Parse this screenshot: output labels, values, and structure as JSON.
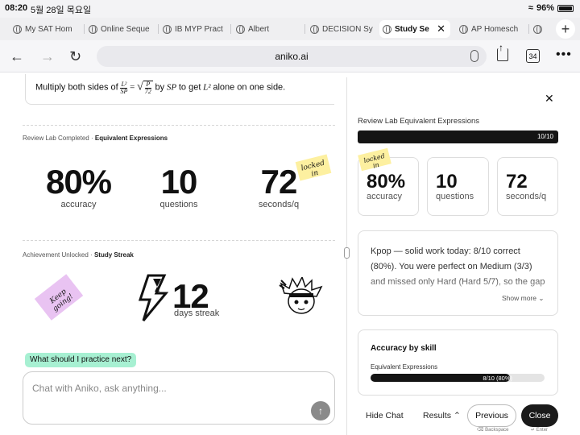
{
  "status": {
    "time": "08:20",
    "date": "5월 28일 목요일",
    "battery": "96%"
  },
  "tabs": [
    {
      "label": "My SAT Hom",
      "active": false
    },
    {
      "label": "Online Seque",
      "active": false
    },
    {
      "label": "IB MYP Pract",
      "active": false
    },
    {
      "label": "Albert",
      "active": false
    },
    {
      "label": "DECISION Sy",
      "active": false
    },
    {
      "label": "Study Se",
      "active": true
    },
    {
      "label": "AP Homesch",
      "active": false
    },
    {
      "label": "",
      "active": false
    }
  ],
  "toolbar": {
    "url": "aniko.ai",
    "tab_count": "34"
  },
  "left": {
    "formula_text_a": "Multiply both sides of",
    "formula_text_b": "by",
    "formula_sp": "SP",
    "formula_text_c": "to get",
    "formula_l2": "L²",
    "formula_text_d": "alone on one side.",
    "frac1_num": "L²",
    "frac1_den": "SP",
    "frac2_num": "P",
    "frac2_den": "72",
    "section1": {
      "label": "Review Lab Completed",
      "sep": "·",
      "topic": "Equivalent Expressions"
    },
    "stats": [
      {
        "value": "80%",
        "label": "accuracy"
      },
      {
        "value": "10",
        "label": "questions"
      },
      {
        "value": "72",
        "label": "seconds/q"
      }
    ],
    "sticky_locked": "locked in",
    "section2": {
      "label": "Achievement Unlocked",
      "sep": "·",
      "topic": "Study Streak"
    },
    "sticky_keep": "Keep going!",
    "streak": {
      "value": "12",
      "label": "days streak"
    },
    "suggestion": "What should I practice next?",
    "chat_placeholder": "Chat with Aniko, ask anything..."
  },
  "right": {
    "title": "Review Lab Equivalent Expressions",
    "progress": {
      "label": "10/10",
      "fraction": 1.0
    },
    "sticky_locked": "locked in",
    "cards": [
      {
        "value": "80%",
        "label": "accuracy"
      },
      {
        "value": "10",
        "label": "questions"
      },
      {
        "value": "72",
        "label": "seconds/q"
      }
    ],
    "summary": "Kpop — solid work today: 8/10 correct (80%). You were perfect on Medium (3/3) and missed only Hard (Hard 5/7), so the gap",
    "show_more": "Show more",
    "skills_title": "Accuracy by skill",
    "skill": {
      "name": "Equivalent Expressions",
      "value": "8/10 (80%)",
      "fraction": 0.8
    }
  },
  "controls": {
    "hide_chat": "Hide Chat",
    "results": "Results",
    "previous": "Previous",
    "close": "Close",
    "hint_backspace": "Backspace",
    "hint_enter": "Enter"
  },
  "colors": {
    "accent_green": "#a7f0d2",
    "sticky_yellow": "#fdf0a0",
    "sticky_pink": "#e9c3f2",
    "dark": "#141414"
  }
}
